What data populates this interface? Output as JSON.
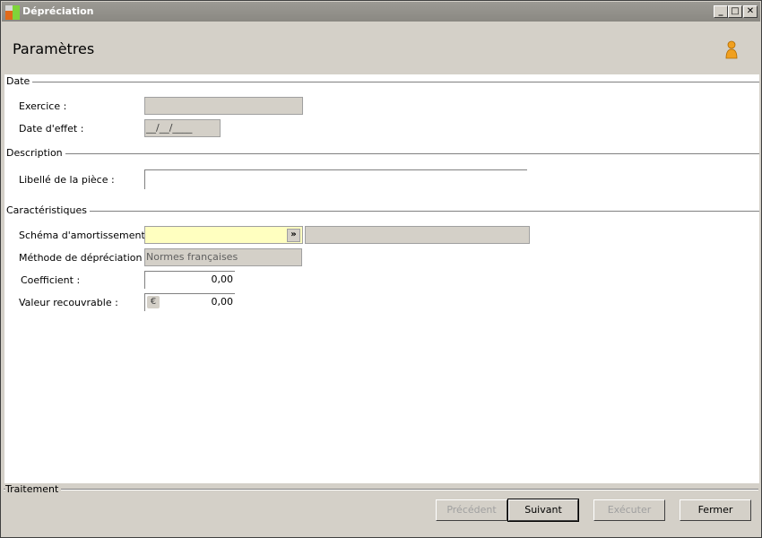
{
  "window": {
    "title": "Dépréciation",
    "minimize_icon": "minimize-icon",
    "maximize_icon": "maximize-icon",
    "close_icon": "close-icon"
  },
  "header": {
    "title": "Paramètres",
    "icon": "user-icon"
  },
  "sections": {
    "date": {
      "label": "Date",
      "exercice_label": "Exercice :",
      "exercice_value": "",
      "date_effet_label": "Date d'effet :",
      "date_effet_value": "__/__/____"
    },
    "description": {
      "label": "Description",
      "libelle_label": "Libellé de la pièce :",
      "libelle_value": ""
    },
    "caracteristiques": {
      "label": "Caractéristiques",
      "schema_label": "Schéma d'amortissement :",
      "schema_value": "",
      "schema_desc": "",
      "methode_label": "Méthode de dépréciation :",
      "methode_value": "Normes françaises",
      "coefficient_label": "Coefficient :",
      "coefficient_value": "0,00",
      "valeur_label": "Valeur recouvrable :",
      "valeur_value": "0,00",
      "currency_symbol": "€"
    }
  },
  "footer": {
    "label": "Traitement",
    "buttons": {
      "precedent": "Précédent",
      "suivant": "Suivant",
      "executer": "Exécuter",
      "fermer": "Fermer"
    }
  },
  "colors": {
    "titlebar": "#8a8882",
    "panel": "#d4d0c8",
    "combo": "#ffffc0",
    "accent_icon": "#f0a020"
  }
}
